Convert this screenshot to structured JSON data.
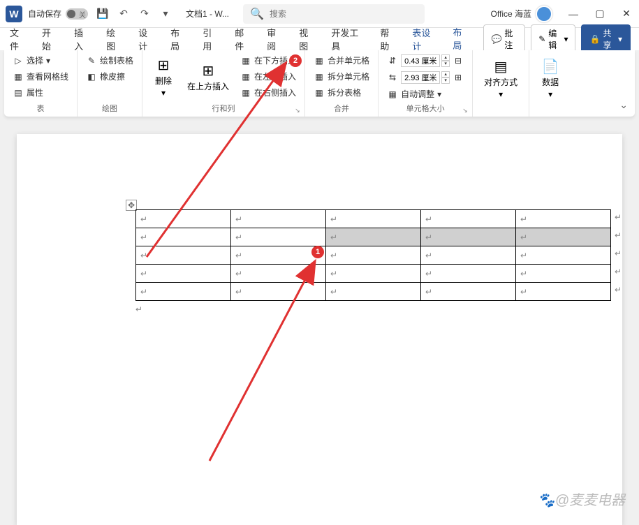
{
  "titlebar": {
    "autosave_label": "自动保存",
    "autosave_state": "关",
    "doc_title": "文档1 - W...",
    "search_placeholder": "搜索",
    "account_name": "Office 海蓝"
  },
  "tabs": {
    "items": [
      "文件",
      "开始",
      "插入",
      "绘图",
      "设计",
      "布局",
      "引用",
      "邮件",
      "审阅",
      "视图",
      "开发工具",
      "帮助"
    ],
    "contextual": [
      "表设计",
      "布局"
    ],
    "active": "布局",
    "comments": "批注",
    "edit": "编辑",
    "share": "共享"
  },
  "ribbon": {
    "g1": {
      "select": "选择",
      "gridlines": "查看网格线",
      "properties": "属性",
      "label": "表"
    },
    "g2": {
      "draw": "绘制表格",
      "eraser": "橡皮擦",
      "label": "绘图"
    },
    "g3": {
      "delete": "删除",
      "above": "在上方插入",
      "below": "在下方插入",
      "left": "在左侧插入",
      "right": "在右侧插入",
      "label": "行和列"
    },
    "g4": {
      "merge": "合并单元格",
      "split": "拆分单元格",
      "split_table": "拆分表格",
      "label": "合并"
    },
    "g5": {
      "height": "0.43 厘米",
      "width": "2.93 厘米",
      "autofit": "自动调整",
      "label": "单元格大小"
    },
    "g6": {
      "align": "对齐方式"
    },
    "g7": {
      "data": "数据"
    }
  },
  "annotations": {
    "badge1": "1",
    "badge2": "2"
  },
  "watermark": "@麦麦电器"
}
